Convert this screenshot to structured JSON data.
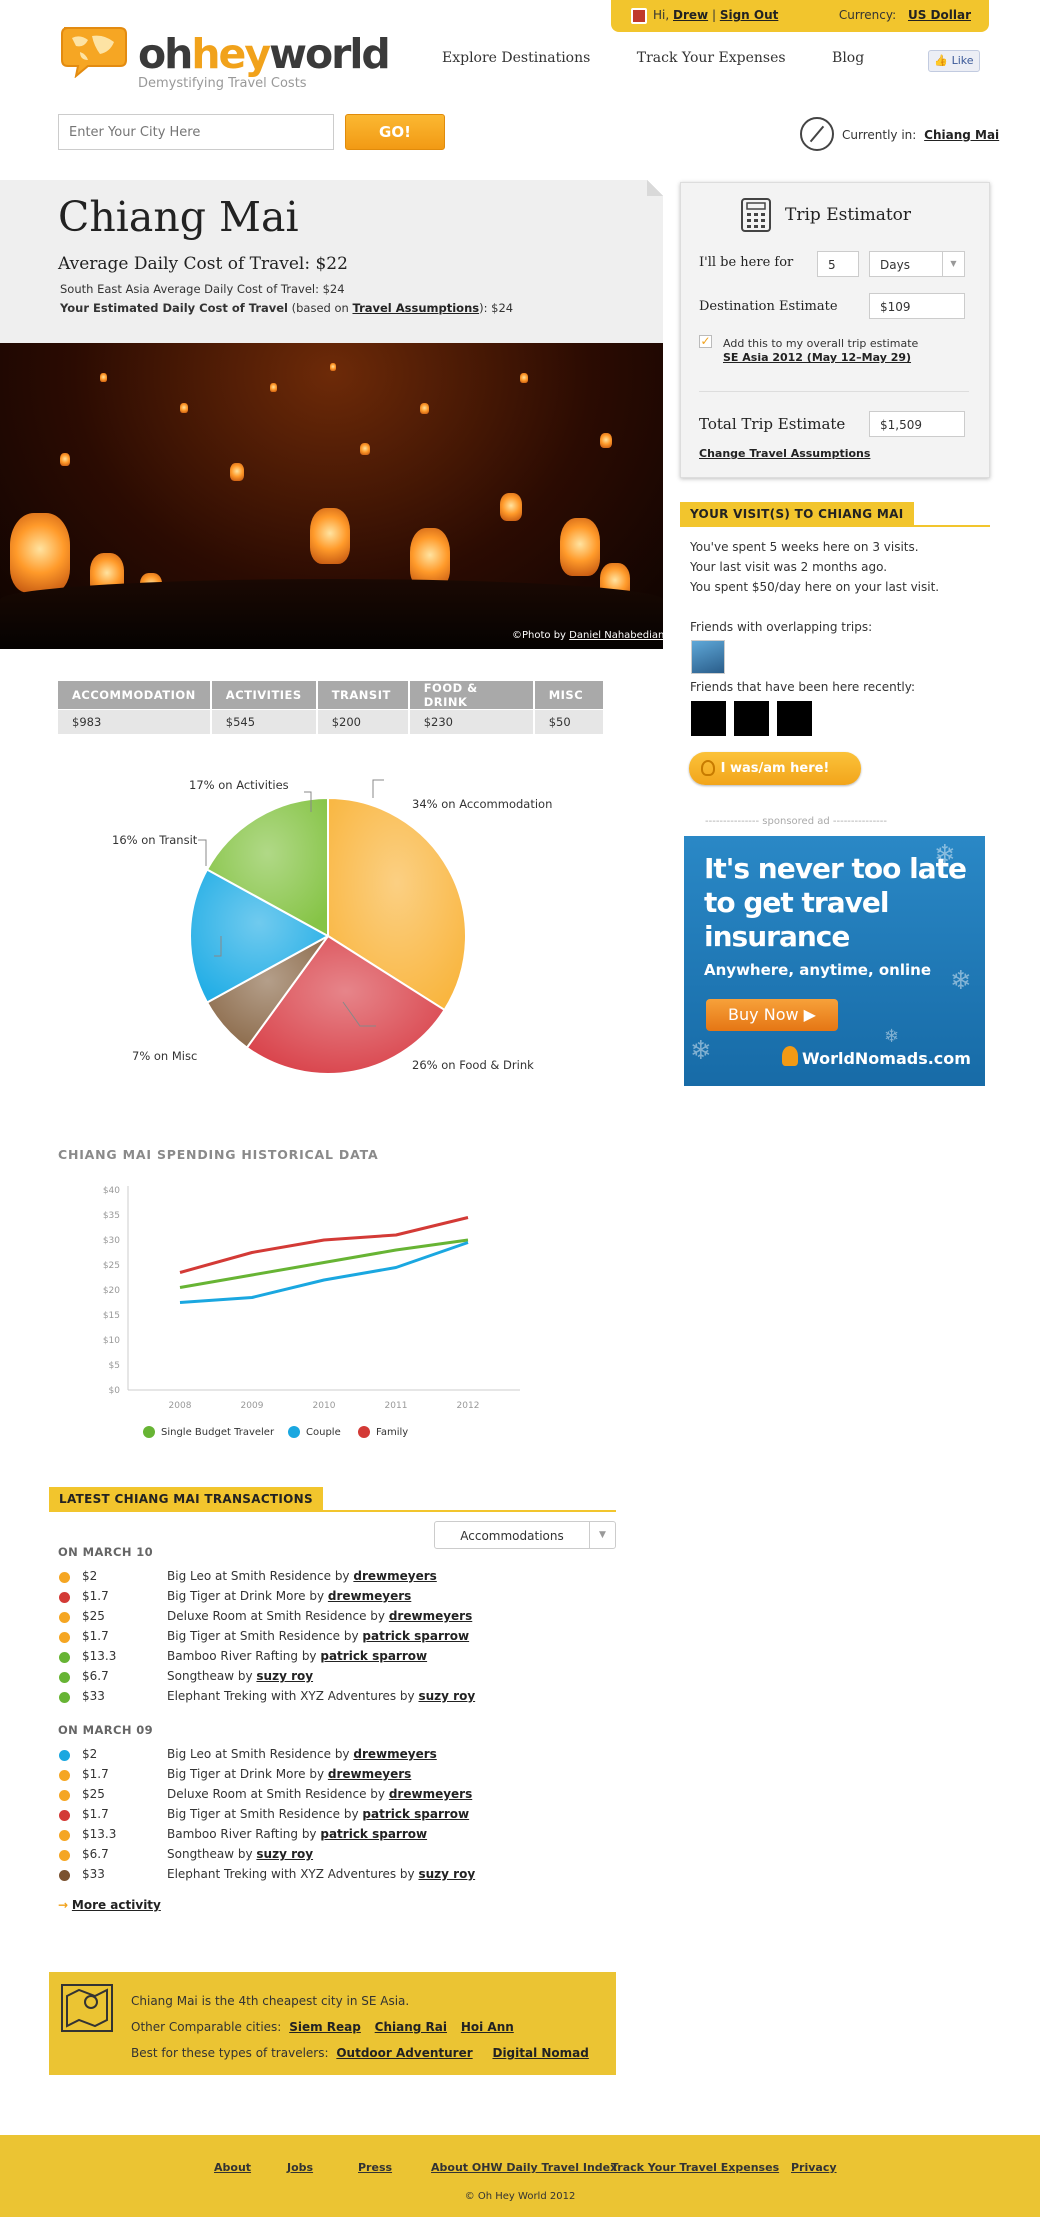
{
  "userbar": {
    "greeting_prefix": "Hi,",
    "user": "Drew",
    "separator": "|",
    "sign_out": "Sign Out",
    "currency_label": "Currency:",
    "currency_value": "US Dollar"
  },
  "brand": {
    "oh": "oh",
    "hey": "hey",
    "world": "world",
    "tagline": "Demystifying Travel Costs"
  },
  "nav": [
    "Explore Destinations",
    "Track Your Expenses",
    "Blog"
  ],
  "fb_like": "Like",
  "search": {
    "placeholder": "Enter Your City Here",
    "go": "GO!"
  },
  "currently_in": {
    "label": "Currently in:",
    "city": "Chiang Mai"
  },
  "city": {
    "name": "Chiang Mai",
    "avg_daily": "Average Daily Cost of Travel: $22",
    "region_avg": "South East Asia Average Daily Cost of Travel: $24",
    "your_est_bold": "Your Estimated Daily Cost of Travel",
    "your_est_mid": "(based on",
    "your_est_link": "Travel Assumptions",
    "your_est_end": "): $24"
  },
  "photo_credit": {
    "prefix": "©Photo by",
    "name": "Daniel Nahabedian"
  },
  "cost_table": {
    "headers": [
      "Accommodation",
      "Activities",
      "Transit",
      "Food & Drink",
      "Misc"
    ],
    "values": [
      "$983",
      "$545",
      "$200",
      "$230",
      "$50"
    ]
  },
  "pie_labels": {
    "accommodation": "34% on Accommodation",
    "activities": "17% on Activities",
    "transit": "16% on Transit",
    "misc": "7% on Misc",
    "food": "26% on Food & Drink"
  },
  "historical": {
    "title": "CHIANG MAI SPENDING HISTORICAL DATA"
  },
  "chart_data": [
    {
      "type": "pie",
      "labels": [
        "Accommodation",
        "Food & Drink",
        "Misc",
        "Transit",
        "Activities"
      ],
      "values": [
        34,
        26,
        7,
        16,
        17
      ],
      "colors": [
        "#f9b640",
        "#d9434b",
        "#8c6b4b",
        "#23aee6",
        "#86c446"
      ]
    },
    {
      "type": "line",
      "x": [
        "2008",
        "2009",
        "2010",
        "2011",
        "2012"
      ],
      "y_ticks": [
        "$0",
        "$5",
        "$10",
        "$15",
        "$20",
        "$25",
        "$30",
        "$35",
        "$40"
      ],
      "ylim": [
        0,
        40
      ],
      "series": [
        {
          "name": "Single Budget Traveler",
          "color": "#67b434",
          "values": [
            20.5,
            23,
            25.5,
            28,
            30
          ]
        },
        {
          "name": "Couple",
          "color": "#1aa7e0",
          "values": [
            17.5,
            18.5,
            22,
            24.5,
            29.5
          ]
        },
        {
          "name": "Family",
          "color": "#d33a36",
          "values": [
            23.5,
            27.5,
            30,
            31,
            34.5
          ]
        }
      ]
    }
  ],
  "transactions": {
    "title": "LATEST CHIANG MAI TRANSACTIONS",
    "filter": "Accommodations",
    "days": [
      {
        "title": "ON MARCH 10",
        "items": [
          {
            "color": "#f5a623",
            "amount": "$2",
            "text": "Big Leo at Smith Residence by",
            "user": "drewmeyers"
          },
          {
            "color": "#d33a36",
            "amount": "$1.7",
            "text": "Big Tiger at Drink More by",
            "user": "drewmeyers"
          },
          {
            "color": "#f5a623",
            "amount": "$25",
            "text": "Deluxe Room at Smith Residence by",
            "user": "drewmeyers"
          },
          {
            "color": "#f5a623",
            "amount": "$1.7",
            "text": "Big Tiger at Smith Residence by",
            "user": "patrick sparrow"
          },
          {
            "color": "#67b434",
            "amount": "$13.3",
            "text": "Bamboo River Rafting by",
            "user": "patrick sparrow"
          },
          {
            "color": "#67b434",
            "amount": "$6.7",
            "text": "Songtheaw by",
            "user": "suzy roy"
          },
          {
            "color": "#67b434",
            "amount": "$33",
            "text": "Elephant Treking with XYZ Adventures by",
            "user": "suzy roy"
          }
        ]
      },
      {
        "title": "ON MARCH 09",
        "items": [
          {
            "color": "#1aa7e0",
            "amount": "$2",
            "text": "Big Leo at Smith Residence by",
            "user": "drewmeyers"
          },
          {
            "color": "#f5a623",
            "amount": "$1.7",
            "text": "Big Tiger at Drink More by",
            "user": "drewmeyers"
          },
          {
            "color": "#f5a623",
            "amount": "$25",
            "text": "Deluxe Room at Smith Residence by",
            "user": "drewmeyers"
          },
          {
            "color": "#d33a36",
            "amount": "$1.7",
            "text": "Big Tiger at Smith Residence by",
            "user": "patrick sparrow"
          },
          {
            "color": "#f5a623",
            "amount": "$13.3",
            "text": "Bamboo River Rafting by",
            "user": "patrick sparrow"
          },
          {
            "color": "#f5a623",
            "amount": "$6.7",
            "text": "Songtheaw by",
            "user": "suzy roy"
          },
          {
            "color": "#7a5230",
            "amount": "$33",
            "text": "Elephant Treking with XYZ Adventures by",
            "user": "suzy roy"
          }
        ]
      }
    ],
    "more": "More activity"
  },
  "summary": {
    "line1": "Chiang Mai is the 4th cheapest city in SE Asia.",
    "line2_label": "Other Comparable cities:",
    "cities": [
      "Siem Reap",
      "Chiang Rai",
      "Hoi Ann"
    ],
    "line3_label": "Best for these types of travelers:",
    "types": [
      "Outdoor Adventurer",
      "Digital Nomad"
    ]
  },
  "footer": {
    "links": [
      "About",
      "Jobs",
      "Press",
      "About OHW Daily Travel Index",
      "Track Your Travel Expenses",
      "Privacy"
    ],
    "copyright": "© Oh Hey World 2012"
  },
  "estimator": {
    "title": "Trip Estimator",
    "here_for_label": "I'll be here for",
    "days_value": "5",
    "unit": "Days",
    "dest_label": "Destination Estimate",
    "dest_value": "$109",
    "add_text": "Add this to my overall trip estimate",
    "trip_link": "SE Asia 2012 (May 12–May 29)",
    "total_label": "Total Trip Estimate",
    "total_value": "$1,509",
    "change_link": "Change Travel Assumptions"
  },
  "visits": {
    "title": "YOUR VISIT(S) TO CHIANG MAI",
    "lines": [
      "You've spent 5 weeks here on 3 visits.",
      "Your last visit was 2 months ago.",
      "You spent $50/day here on your last visit."
    ],
    "overlap_label": "Friends with overlapping trips:",
    "recent_label": "Friends that have been here recently:",
    "button": "I was/am here!"
  },
  "ad": {
    "sponsored": "--------------- sponsored ad ---------------",
    "headline": "It's never too late to get travel insurance",
    "sub": "Anywhere, anytime, online",
    "buy": "Buy Now ▶",
    "brand": "WorldNomads.com"
  }
}
